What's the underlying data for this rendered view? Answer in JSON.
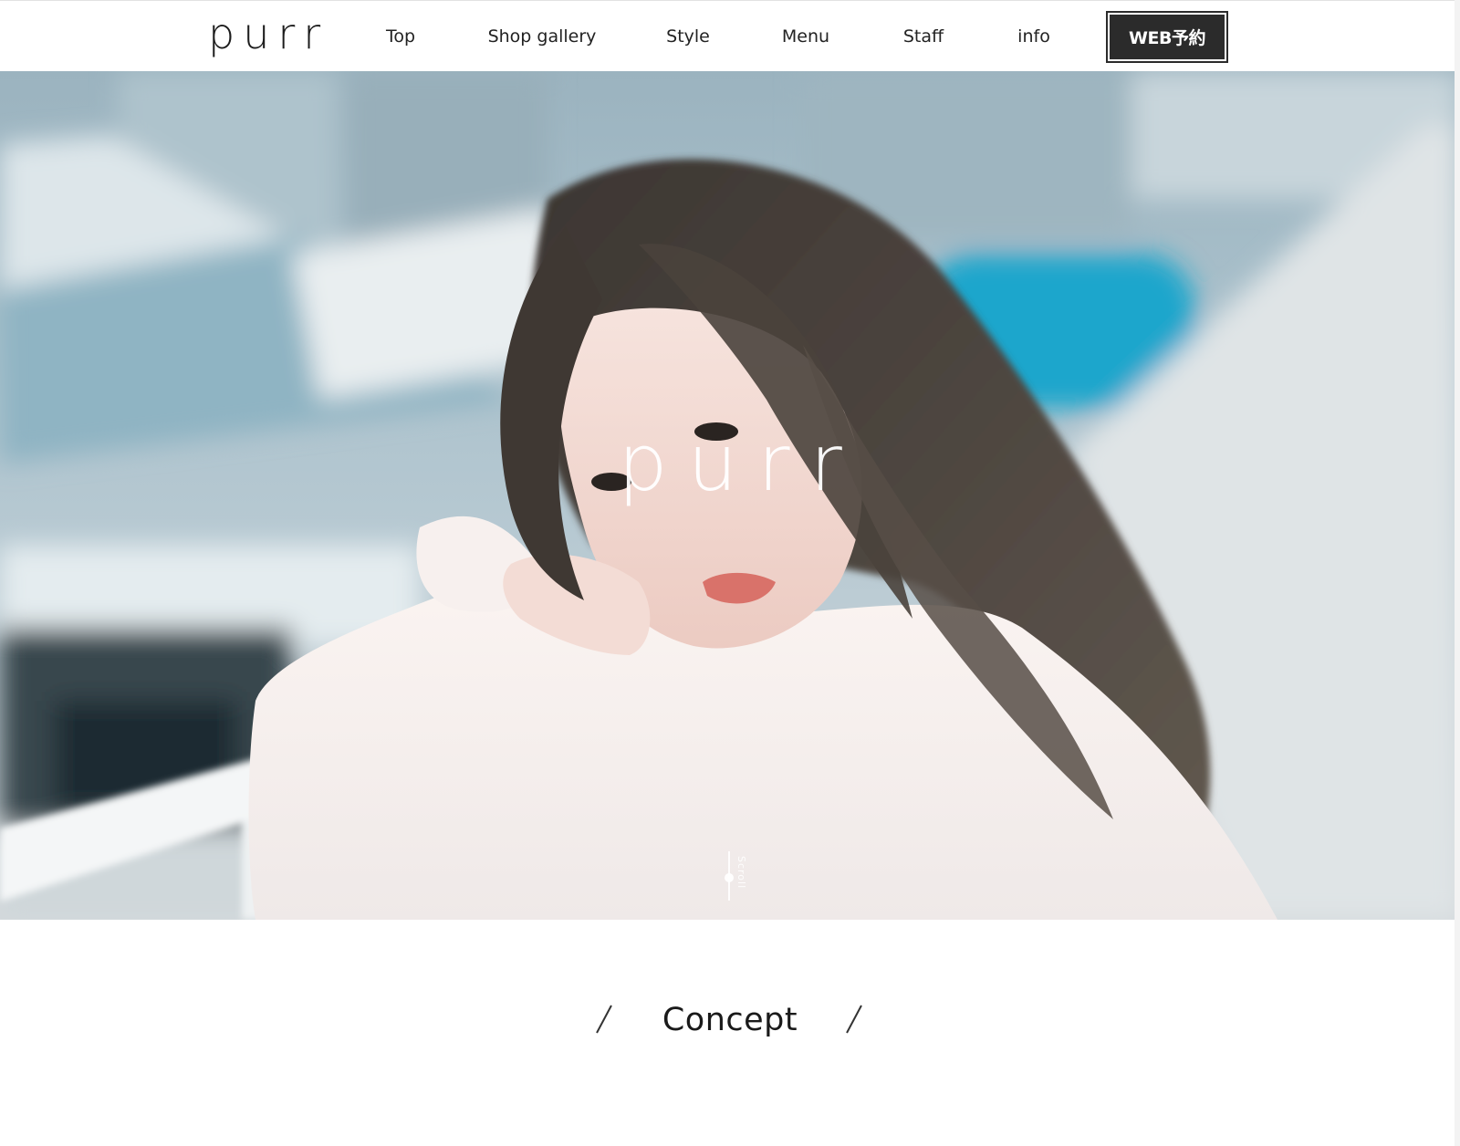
{
  "header": {
    "logo": "purr",
    "nav": [
      {
        "label": "Top",
        "name": "nav-top"
      },
      {
        "label": "Shop gallery",
        "name": "nav-shop-gallery"
      },
      {
        "label": "Style",
        "name": "nav-style"
      },
      {
        "label": "Menu",
        "name": "nav-menu"
      },
      {
        "label": "Staff",
        "name": "nav-staff"
      },
      {
        "label": "info",
        "name": "nav-info"
      }
    ],
    "reserve_label": "WEB予約"
  },
  "hero": {
    "title": "purr",
    "scroll_label": "Scroll"
  },
  "concept": {
    "heading": "Concept"
  },
  "colors": {
    "accent": "#2b2b2b",
    "background": "#ffffff"
  }
}
